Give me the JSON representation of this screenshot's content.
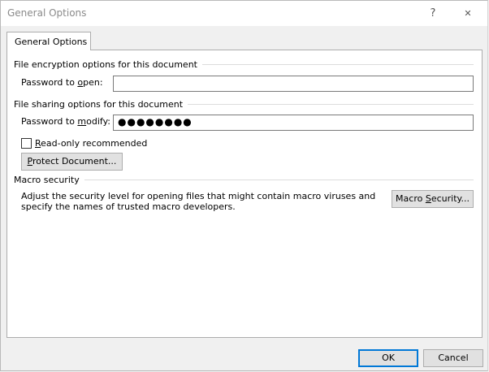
{
  "window": {
    "title": "General Options",
    "help_glyph": "?",
    "close_glyph": "✕",
    "icons": [
      "help-icon",
      "close-icon"
    ]
  },
  "tabs": [
    {
      "label": "General Options",
      "selected": true
    }
  ],
  "encryption": {
    "heading": "File encryption options for this document",
    "password_label_pre": "Password to ",
    "password_label_hotkey": "o",
    "password_label_post": "pen:",
    "password_value": ""
  },
  "sharing": {
    "heading": "File sharing options for this document",
    "password_label_pre": "Password to ",
    "password_label_hotkey": "m",
    "password_label_post": "odify:",
    "password_value": "●●●●●●●●",
    "readonly_hotkey": "R",
    "readonly_rest": "ead-only recommended",
    "readonly_checked": false,
    "protect_hotkey": "P",
    "protect_rest": "rotect Document..."
  },
  "macro": {
    "heading": "Macro security",
    "description": "Adjust the security level for opening files that might contain macro viruses and specify the names of trusted macro developers.",
    "button_pre": "Macro ",
    "button_hotkey": "S",
    "button_post": "ecurity..."
  },
  "footer": {
    "ok_label": "OK",
    "cancel_label": "Cancel"
  },
  "colors": {
    "default_button_border": "#0078d7",
    "dialog_background": "#f0f0f0",
    "title_text": "#8a8a8a"
  }
}
